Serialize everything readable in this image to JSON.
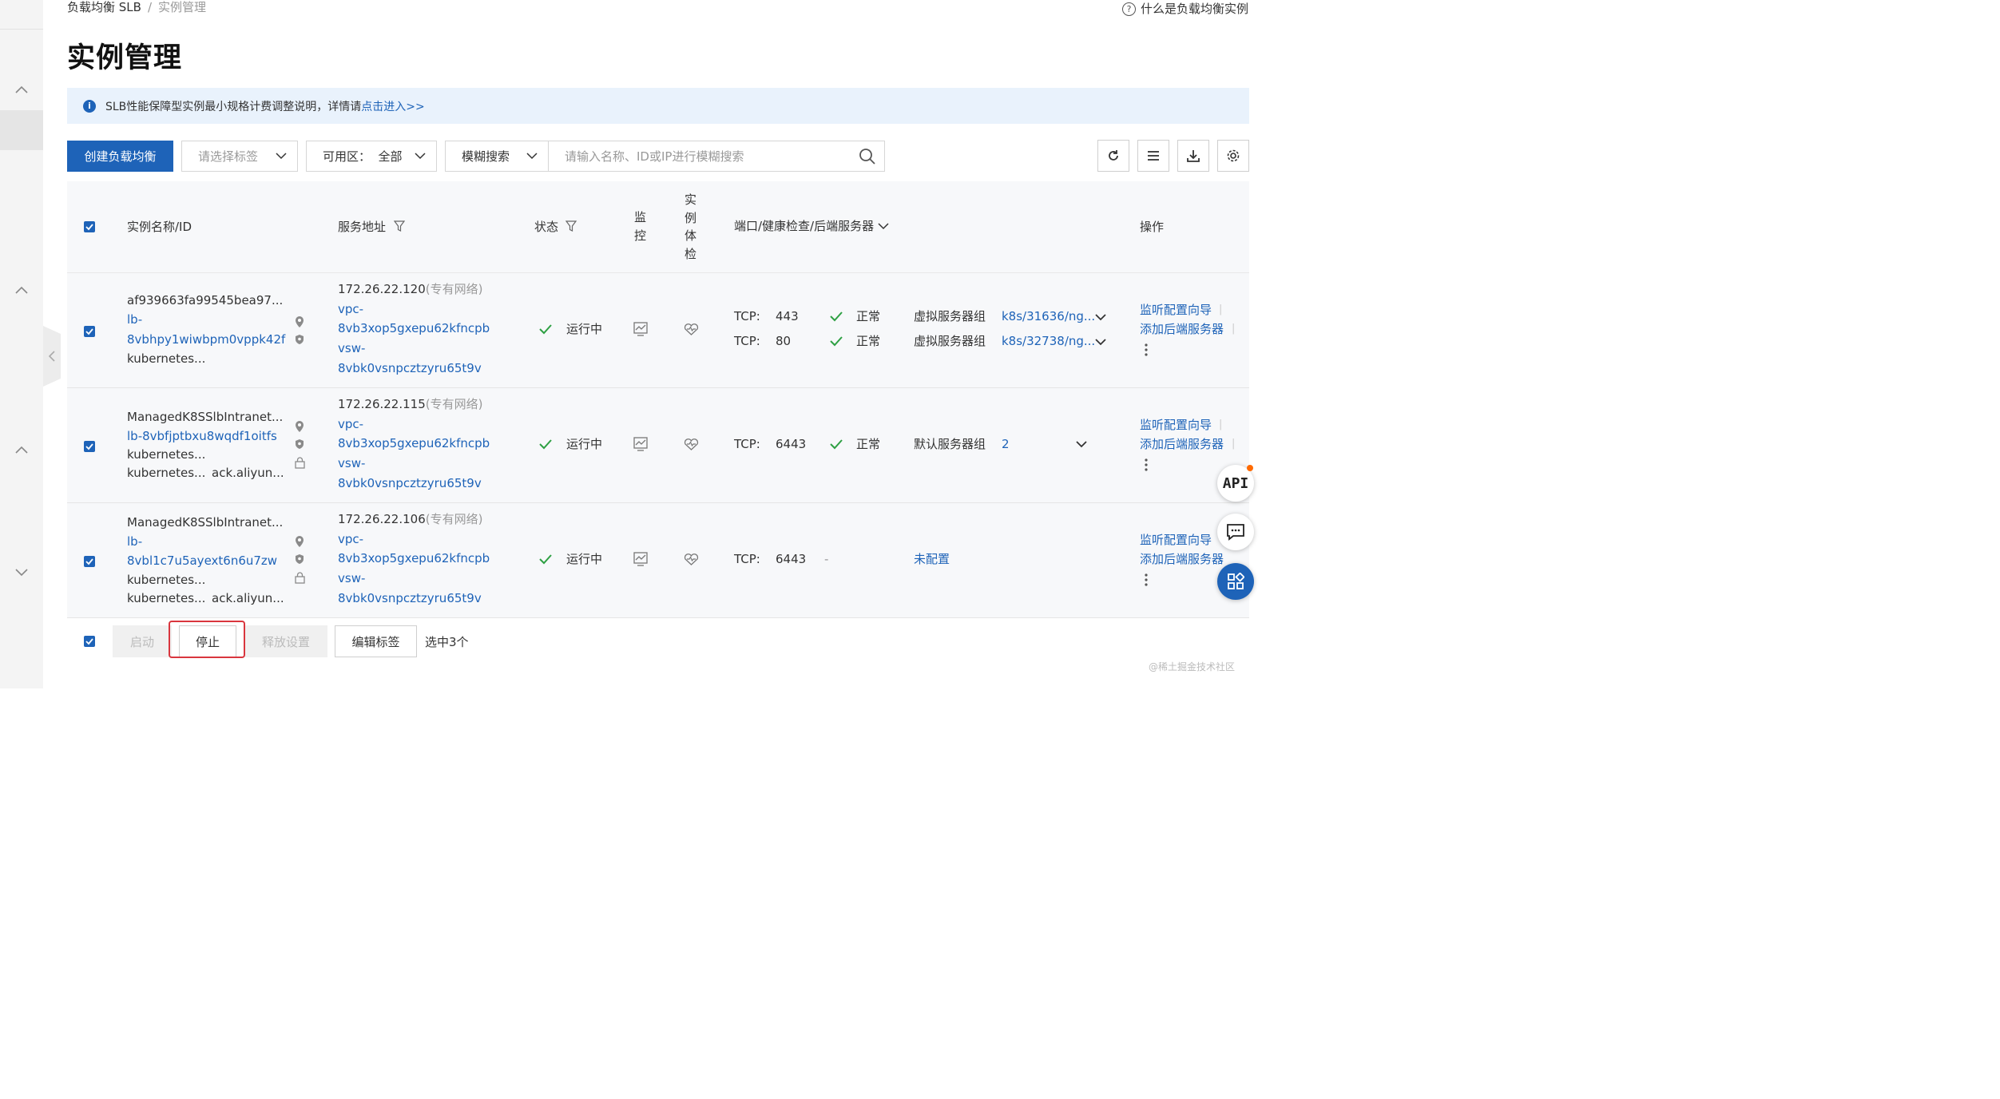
{
  "breadcrumb": {
    "root": "负载均衡 SLB",
    "separator": "/",
    "current": "实例管理"
  },
  "help_link": {
    "icon_char": "?",
    "label": "什么是负载均衡实例"
  },
  "page_title": "实例管理",
  "notice": {
    "icon_char": "i",
    "text": "SLB性能保障型实例最小规格计费调整说明，详情请",
    "link": "点击进入>>"
  },
  "toolbar": {
    "create_label": "创建负载均衡",
    "tag_select_placeholder": "请选择标签",
    "zone_select": "可用区：  全部",
    "search_mode": "模糊搜索",
    "search_placeholder": "请输入名称、ID或IP进行模糊搜索",
    "tools": [
      "refresh-icon",
      "list-icon",
      "download-icon",
      "gear-icon"
    ]
  },
  "table": {
    "headers": {
      "name": "实例名称/ID",
      "address": "服务地址",
      "status": "状态",
      "monitor_1": "监",
      "monitor_2": "控",
      "exam_1": "实",
      "exam_2": "例",
      "exam_3": "体",
      "exam_4": "检",
      "ports": "端口/健康检查/后端服务器",
      "ops": "操作"
    },
    "rows": [
      {
        "name_lines": [
          "af939663fa99545bea97...",
          "lb-",
          "8vbhpy1wiwbpm0vppk42f",
          "kubernetes..."
        ],
        "addr_ip": "172.26.22.120",
        "addr_type": "(专有网络)",
        "vpc_1": "vpc-",
        "vpc_2": "8vb3xop5gxepu62kfncpb",
        "vsw_1": "vsw-",
        "vsw_2": "8vbk0vsnpcztzyru65t9v",
        "status": "运行中",
        "listeners": [
          {
            "proto": "TCP:",
            "port": "443",
            "health": "正常",
            "group": "虚拟服务器组",
            "target": "k8s/31636/ng..."
          },
          {
            "proto": "TCP:",
            "port": "80",
            "health": "正常",
            "group": "虚拟服务器组",
            "target": "k8s/32738/ng..."
          }
        ],
        "op_1": "监听配置向导",
        "op_2": "添加后端服务器"
      },
      {
        "name_lines": [
          "ManagedK8SSlbIntranet...",
          "lb-8vbfjptbxu8wqdf1oitfs",
          "kubernetes...",
          "kubernetes..."
        ],
        "name_extra": "ack.aliyun...",
        "addr_ip": "172.26.22.115",
        "addr_type": "(专有网络)",
        "vpc_1": "vpc-",
        "vpc_2": "8vb3xop5gxepu62kfncpb",
        "vsw_1": "vsw-",
        "vsw_2": "8vbk0vsnpcztzyru65t9v",
        "status": "运行中",
        "listeners": [
          {
            "proto": "TCP:",
            "port": "6443",
            "health": "正常",
            "group": "默认服务器组",
            "target": "2"
          }
        ],
        "op_1": "监听配置向导",
        "op_2": "添加后端服务器"
      },
      {
        "name_lines": [
          "ManagedK8SSlbIntranet...",
          "lb-",
          "8vbl1c7u5ayext6n6u7zw",
          "kubernetes...",
          "kubernetes..."
        ],
        "name_extra": "ack.aliyun...",
        "addr_ip": "172.26.22.106",
        "addr_type": "(专有网络)",
        "vpc_1": "vpc-",
        "vpc_2": "8vb3xop5gxepu62kfncpb",
        "vsw_1": "vsw-",
        "vsw_2": "8vbk0vsnpcztzyru65t9v",
        "status": "运行中",
        "listeners": [
          {
            "proto": "TCP:",
            "port": "6443",
            "health": "-",
            "group": "未配置",
            "target": ""
          }
        ],
        "op_1": "监听配置向导",
        "op_2": "添加后端服务器"
      }
    ]
  },
  "bulk_actions": {
    "start": "启动",
    "stop": "停止",
    "release": "释放设置",
    "edit_tags": "编辑标签",
    "selected": "选中3个"
  },
  "floating": {
    "api_label": "API"
  },
  "watermark": "@稀土掘金技术社区",
  "colors": {
    "primary": "#1e63b8",
    "success": "#2ea043",
    "notice_bg": "#e9f2fc",
    "danger": "#d9363e"
  }
}
